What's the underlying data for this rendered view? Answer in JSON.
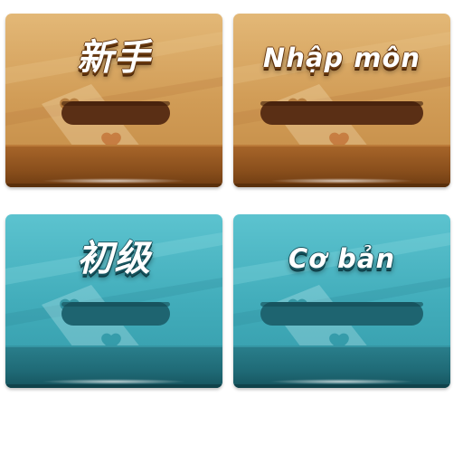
{
  "cards": [
    {
      "label": "新手",
      "theme": "gold"
    },
    {
      "label": "Nhập môn",
      "theme": "gold"
    },
    {
      "label": "初级",
      "theme": "teal"
    },
    {
      "label": "Cơ bản",
      "theme": "teal"
    }
  ],
  "colors": {
    "gold_top": "#dcae6c",
    "gold_mid": "#c98f4a",
    "gold_band": "#9a5a22",
    "gold_pill": "#5a2f15",
    "teal_top": "#4fb7c4",
    "teal_mid": "#3aa2b1",
    "teal_band": "#1f6c78",
    "teal_pill": "#1e6470"
  }
}
